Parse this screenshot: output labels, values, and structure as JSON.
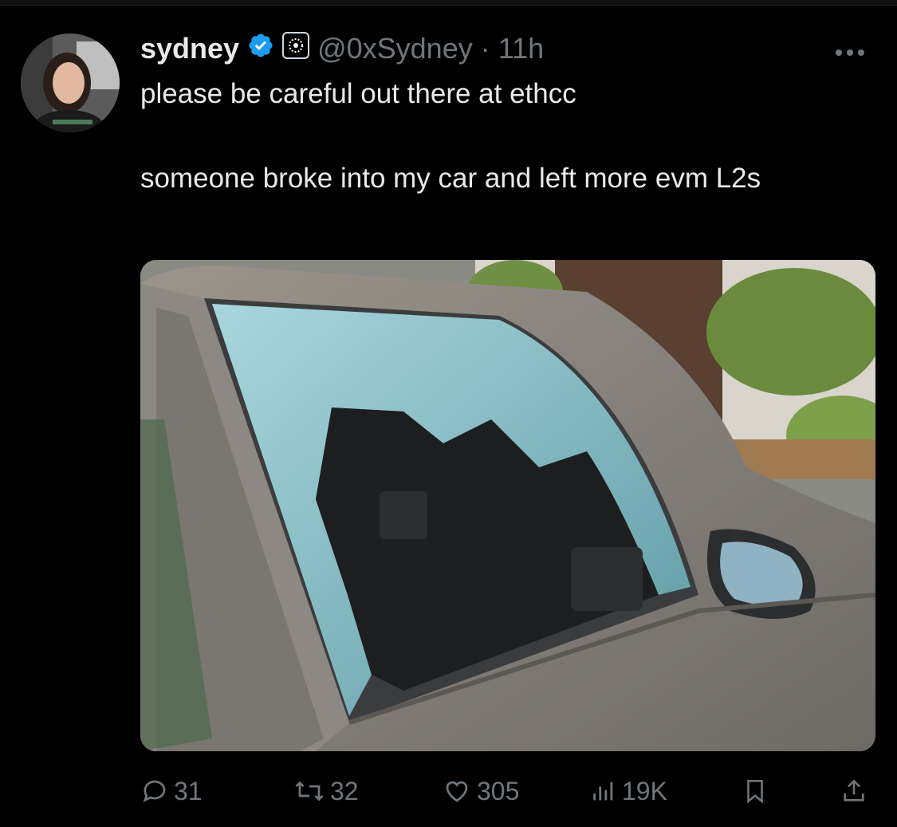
{
  "tweet": {
    "author_name": "sydney",
    "handle": "@0xSydney",
    "separator": "·",
    "time": "11h",
    "text_line1": "please be careful out there at ethcc",
    "text_line2": "someone broke into my car and left more evm L2s",
    "media_icon": "photo-of-car-with-broken-window"
  },
  "actions": {
    "replies": "31",
    "reposts": "32",
    "likes": "305",
    "views": "19K"
  },
  "icons": {
    "verified": "verified-badge-icon",
    "org": "affiliate-org-badge-icon",
    "more": "more-options-icon",
    "reply": "reply-icon",
    "repost": "repost-icon",
    "like": "like-icon",
    "views": "views-icon",
    "bookmark": "bookmark-icon",
    "share": "share-icon"
  },
  "colors": {
    "background": "#000000",
    "text": "#e7e9ea",
    "muted": "#71767b",
    "verified": "#1d9bf0"
  }
}
